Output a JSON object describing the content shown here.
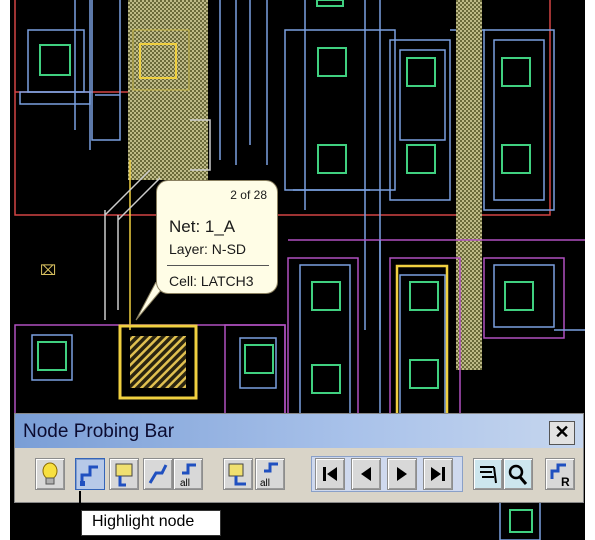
{
  "tooltip": {
    "count": "2 of 28",
    "net": "Net: 1_A",
    "layer": "Layer: N-SD",
    "cell": "Cell: LATCH3"
  },
  "probing_bar": {
    "title": "Node Probing Bar",
    "close_label": "✕",
    "tooltip": "Highlight node",
    "buttons": [
      {
        "name": "lightbulb-icon",
        "label": ""
      },
      {
        "name": "highlight-node-button",
        "label": ""
      },
      {
        "name": "probe-tip-button",
        "label": ""
      },
      {
        "name": "highlight-all-button",
        "label": ""
      },
      {
        "name": "highlight-all-nets-button",
        "label": "all"
      },
      {
        "name": "probe-list-button",
        "label": ""
      },
      {
        "name": "probe-all-button",
        "label": "all"
      },
      {
        "name": "first-button",
        "label": ""
      },
      {
        "name": "previous-button",
        "label": ""
      },
      {
        "name": "next-button",
        "label": ""
      },
      {
        "name": "last-button",
        "label": ""
      },
      {
        "name": "select-probe-button",
        "label": ""
      },
      {
        "name": "zoom-button",
        "label": ""
      },
      {
        "name": "report-button",
        "label": "R"
      }
    ]
  },
  "colors": {
    "layout_bg": "#000000",
    "metal_blue": "#7aa0e0",
    "poly_red": "#d24444",
    "diffusion_purple": "#b050c0",
    "contact_green": "#40d080",
    "highlight_yellow": "#f0d040",
    "titlebar_start": "#7a9ed6"
  }
}
